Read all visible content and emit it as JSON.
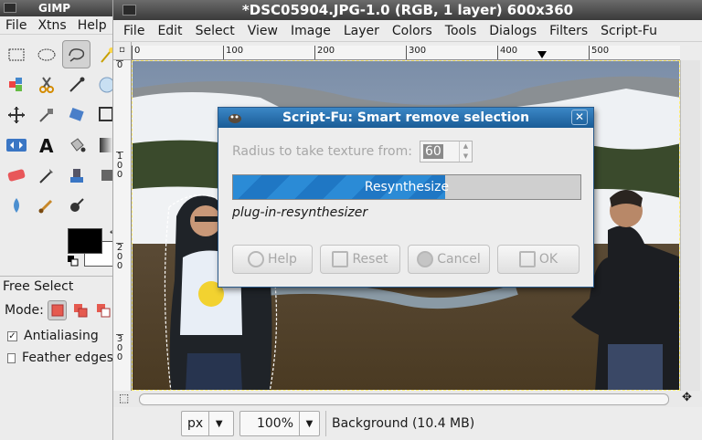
{
  "toolbox": {
    "title": "GIMP",
    "menu": [
      "File",
      "Xtns",
      "Help"
    ],
    "tool_options": {
      "title": "Free Select",
      "mode_label": "Mode:",
      "antialiasing_label": "Antialiasing",
      "antialiasing_checked": true,
      "feather_label": "Feather edges",
      "feather_checked": false
    },
    "foreground_color": "#000000",
    "background_color": "#ffffff"
  },
  "image_window": {
    "title": "*DSC05904.JPG-1.0 (RGB, 1 layer) 600x360",
    "menu": [
      "File",
      "Edit",
      "Select",
      "View",
      "Image",
      "Layer",
      "Colors",
      "Tools",
      "Dialogs",
      "Filters",
      "Script-Fu"
    ],
    "hruler_labels": [
      "0",
      "100",
      "200",
      "300",
      "400",
      "500"
    ],
    "vruler_labels": [
      "0",
      "100",
      "200",
      "300"
    ],
    "unit": "px",
    "zoom": "100%",
    "status": "Background (10.4 MB)"
  },
  "dialog": {
    "title": "Script-Fu: Smart remove selection",
    "radius_label": "Radius to take texture from:",
    "radius_value": "60",
    "progress_label": "Resynthesize",
    "progress_fraction": 0.61,
    "procedure_name": "plug-in-resynthesizer",
    "buttons": {
      "help": "Help",
      "reset": "Reset",
      "cancel": "Cancel",
      "ok": "OK"
    }
  },
  "colors": {
    "dialog_title": "#1a5c96",
    "progress": "#2b8bd6"
  }
}
